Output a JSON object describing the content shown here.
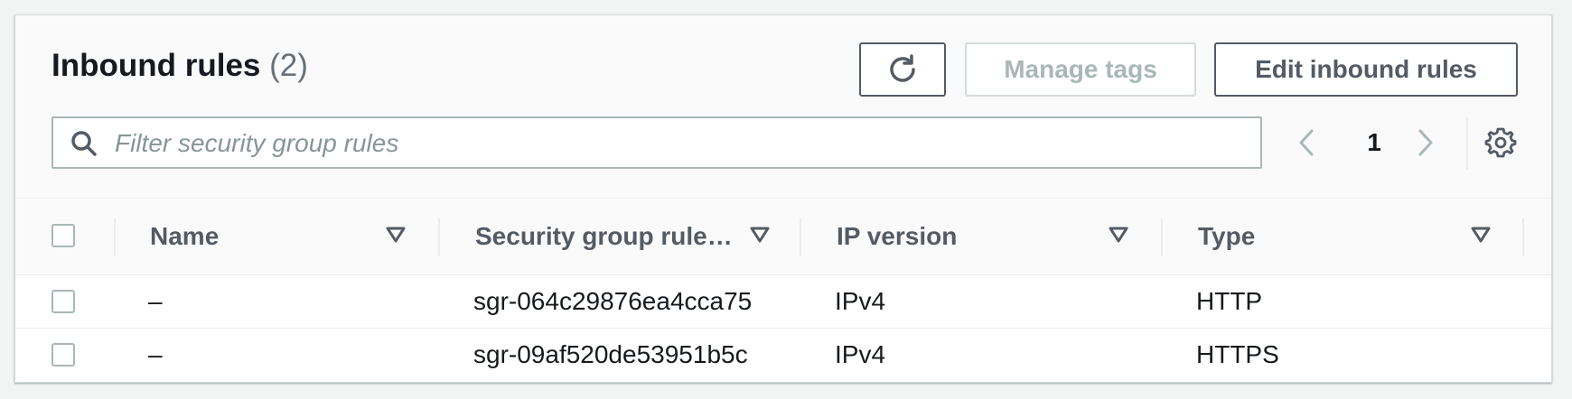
{
  "header": {
    "title": "Inbound rules",
    "count": "(2)",
    "buttons": {
      "refresh_icon": "refresh-icon",
      "manage_tags": "Manage tags",
      "edit_inbound_rules": "Edit inbound rules"
    }
  },
  "search": {
    "placeholder": "Filter security group rules",
    "value": ""
  },
  "pagination": {
    "current_page": "1"
  },
  "table": {
    "columns": [
      {
        "label": "Name"
      },
      {
        "label": "Security group rule…"
      },
      {
        "label": "IP version"
      },
      {
        "label": "Type"
      }
    ],
    "rows": [
      {
        "name": "–",
        "rule_id": "sgr-064c29876ea4cca75",
        "ip_version": "IPv4",
        "type": "HTTP"
      },
      {
        "name": "–",
        "rule_id": "sgr-09af520de53951b5c",
        "ip_version": "IPv4",
        "type": "HTTPS"
      }
    ]
  },
  "colors": {
    "background": "#f2f3f3",
    "panel": "#ffffff",
    "primary_text": "#16191f",
    "secondary_text": "#545b64",
    "disabled_text": "#aab7b8"
  }
}
